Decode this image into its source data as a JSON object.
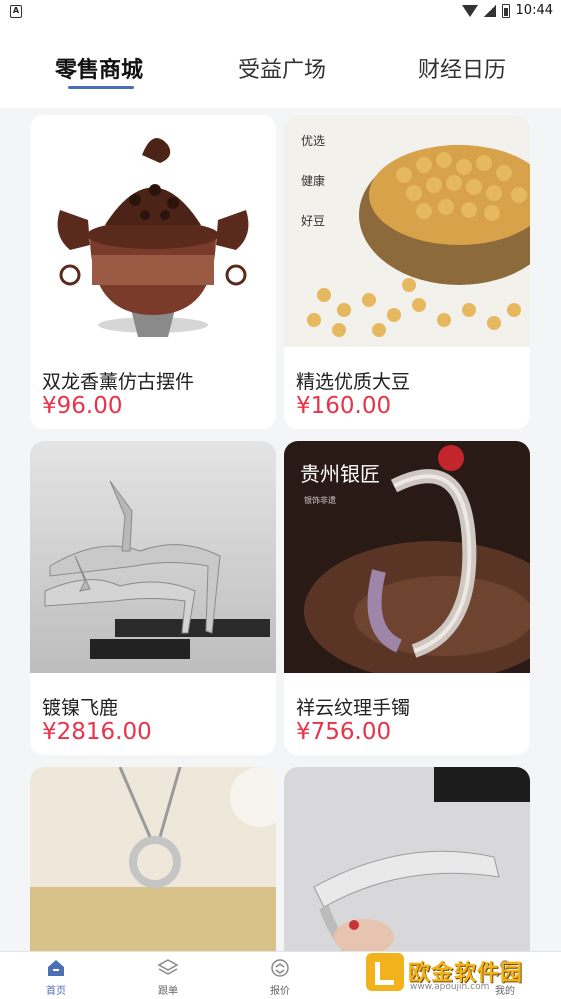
{
  "status_bar": {
    "time": "10:44"
  },
  "tabs": [
    {
      "label": "零售商城",
      "active": true
    },
    {
      "label": "受益广场",
      "active": false
    },
    {
      "label": "财经日历",
      "active": false
    }
  ],
  "products": [
    {
      "name": "双龙香薰仿古摆件",
      "price": "¥96.00"
    },
    {
      "name": "精选优质大豆",
      "price": "¥160.00",
      "image_text": [
        "优选",
        "健康",
        "好豆"
      ]
    },
    {
      "name": "镀镍飞鹿",
      "price": "¥2816.00"
    },
    {
      "name": "祥云纹理手镯",
      "price": "¥756.00",
      "image_text": [
        "贵州银匠",
        "银饰非遗"
      ]
    },
    {
      "name": "",
      "price": ""
    },
    {
      "name": "",
      "price": ""
    }
  ],
  "bottom_nav": [
    {
      "label": "首页",
      "icon": "home-icon",
      "active": true
    },
    {
      "label": "跟单",
      "icon": "layers-icon",
      "active": false
    },
    {
      "label": "报价",
      "icon": "quote-icon",
      "active": false
    },
    {
      "label": "",
      "icon": "",
      "active": false
    },
    {
      "label": "我的",
      "icon": "profile-icon",
      "active": false
    }
  ],
  "watermark": {
    "text": "欧金软件园",
    "url": "www.apoujin.com"
  },
  "colors": {
    "accent": "#4a6fb5",
    "price": "#e8334a",
    "watermark": "#f2b21b"
  }
}
